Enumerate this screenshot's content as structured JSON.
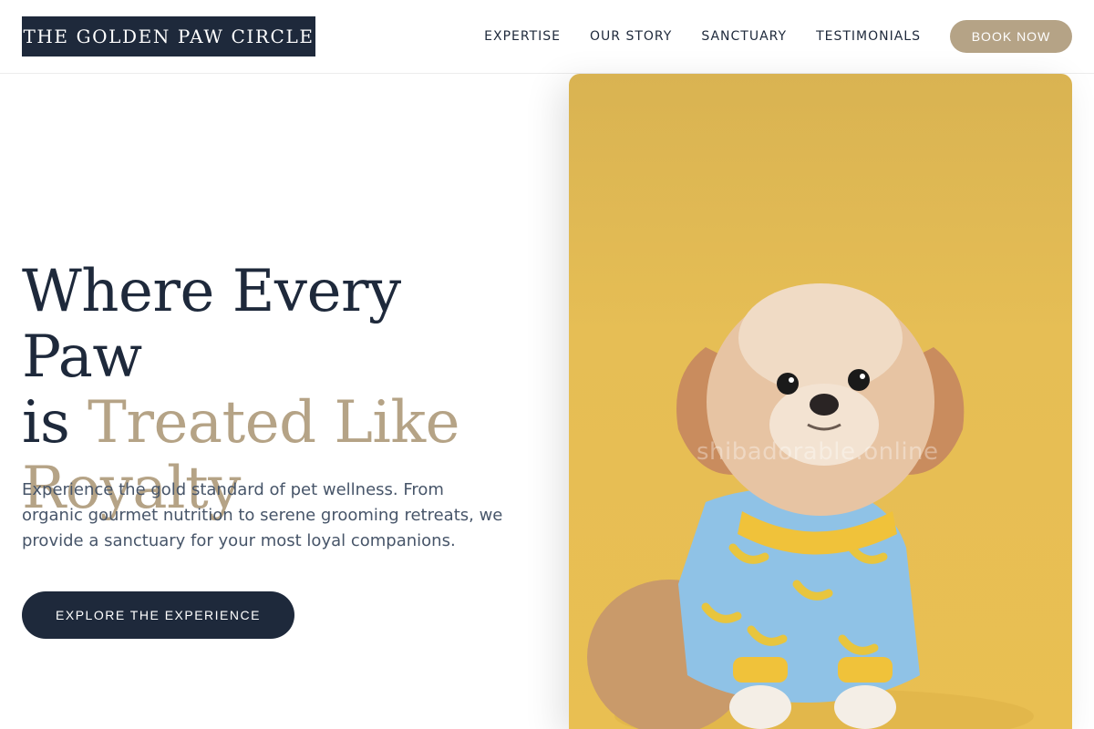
{
  "header": {
    "logo_text": "THE GOLDEN PAW CIRCLE",
    "nav_links": [
      "EXPERTISE",
      "OUR STORY",
      "SANCTUARY",
      "TESTIMONIALS"
    ],
    "book_label": "BOOK NOW"
  },
  "hero": {
    "title_part1": "Where Every Paw",
    "title_part2": "is ",
    "title_accent": "Treated Like Royalty",
    "subtitle": "Experience the gold standard of pet wellness. From organic gourmet nutrition to serene grooming retreats, we provide a sanctuary for your most loyal companions.",
    "cta_label": "EXPLORE THE EXPERIENCE",
    "image_watermark": "shibadorable.online"
  },
  "colors": {
    "navy": "#1e293b",
    "gold_accent": "#b5a386",
    "image_background": "#e6be55"
  }
}
